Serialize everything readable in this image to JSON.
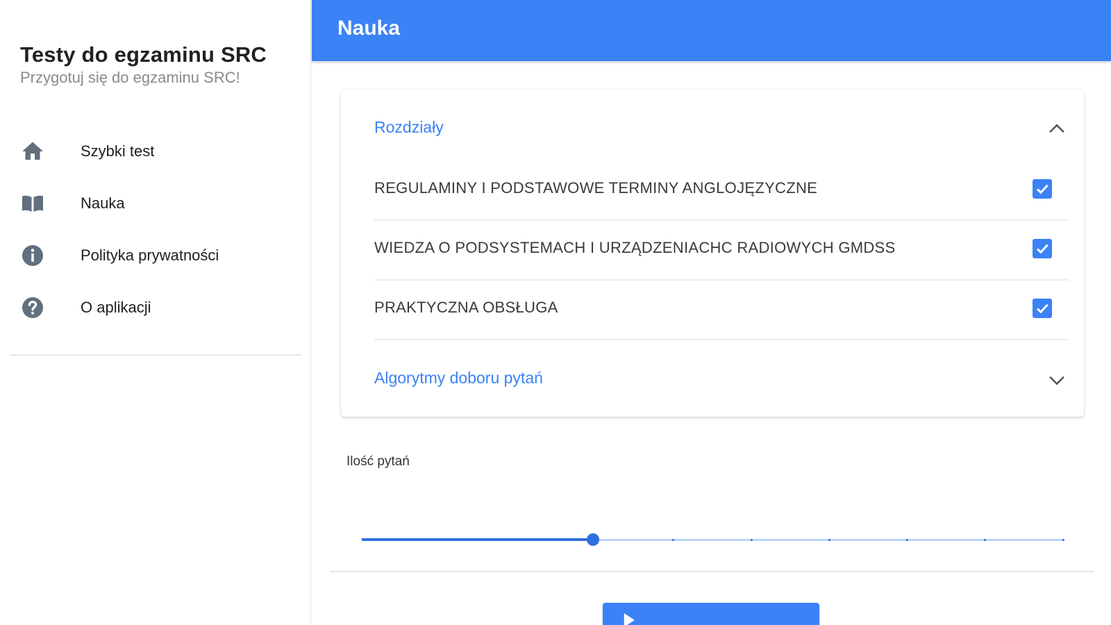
{
  "sidebar": {
    "title": "Testy do egzaminu SRC",
    "subtitle": "Przygotuj się do egzaminu SRC!",
    "items": [
      {
        "label": "Szybki test",
        "icon": "home-icon"
      },
      {
        "label": "Nauka",
        "icon": "book-icon"
      },
      {
        "label": "Polityka prywatności",
        "icon": "info-icon"
      },
      {
        "label": "O aplikacji",
        "icon": "help-icon"
      }
    ]
  },
  "header": {
    "title": "Nauka"
  },
  "chapters": {
    "title": "Rozdziały",
    "expanded": true,
    "items": [
      {
        "label": "REGULAMINY I PODSTAWOWE TERMINY ANGLOJĘZYCZNE",
        "checked": true
      },
      {
        "label": "WIEDZA O PODSYSTEMACH I URZĄDZENIACHC RADIOWYCH GMDSS",
        "checked": true
      },
      {
        "label": "PRAKTYCZNA OBSŁUGA",
        "checked": true
      }
    ]
  },
  "algorithms": {
    "title": "Algorytmy doboru pytań",
    "expanded": false
  },
  "question_count": {
    "label": "Ilość pytań",
    "fraction": 0.33,
    "steps": 9
  },
  "start_button": {
    "label": "",
    "icon": "play-icon"
  },
  "colors": {
    "primary": "#3b82f6",
    "slider": "#2f6fe0",
    "sidebar_icon": "#616f7f",
    "text": "#212121"
  }
}
